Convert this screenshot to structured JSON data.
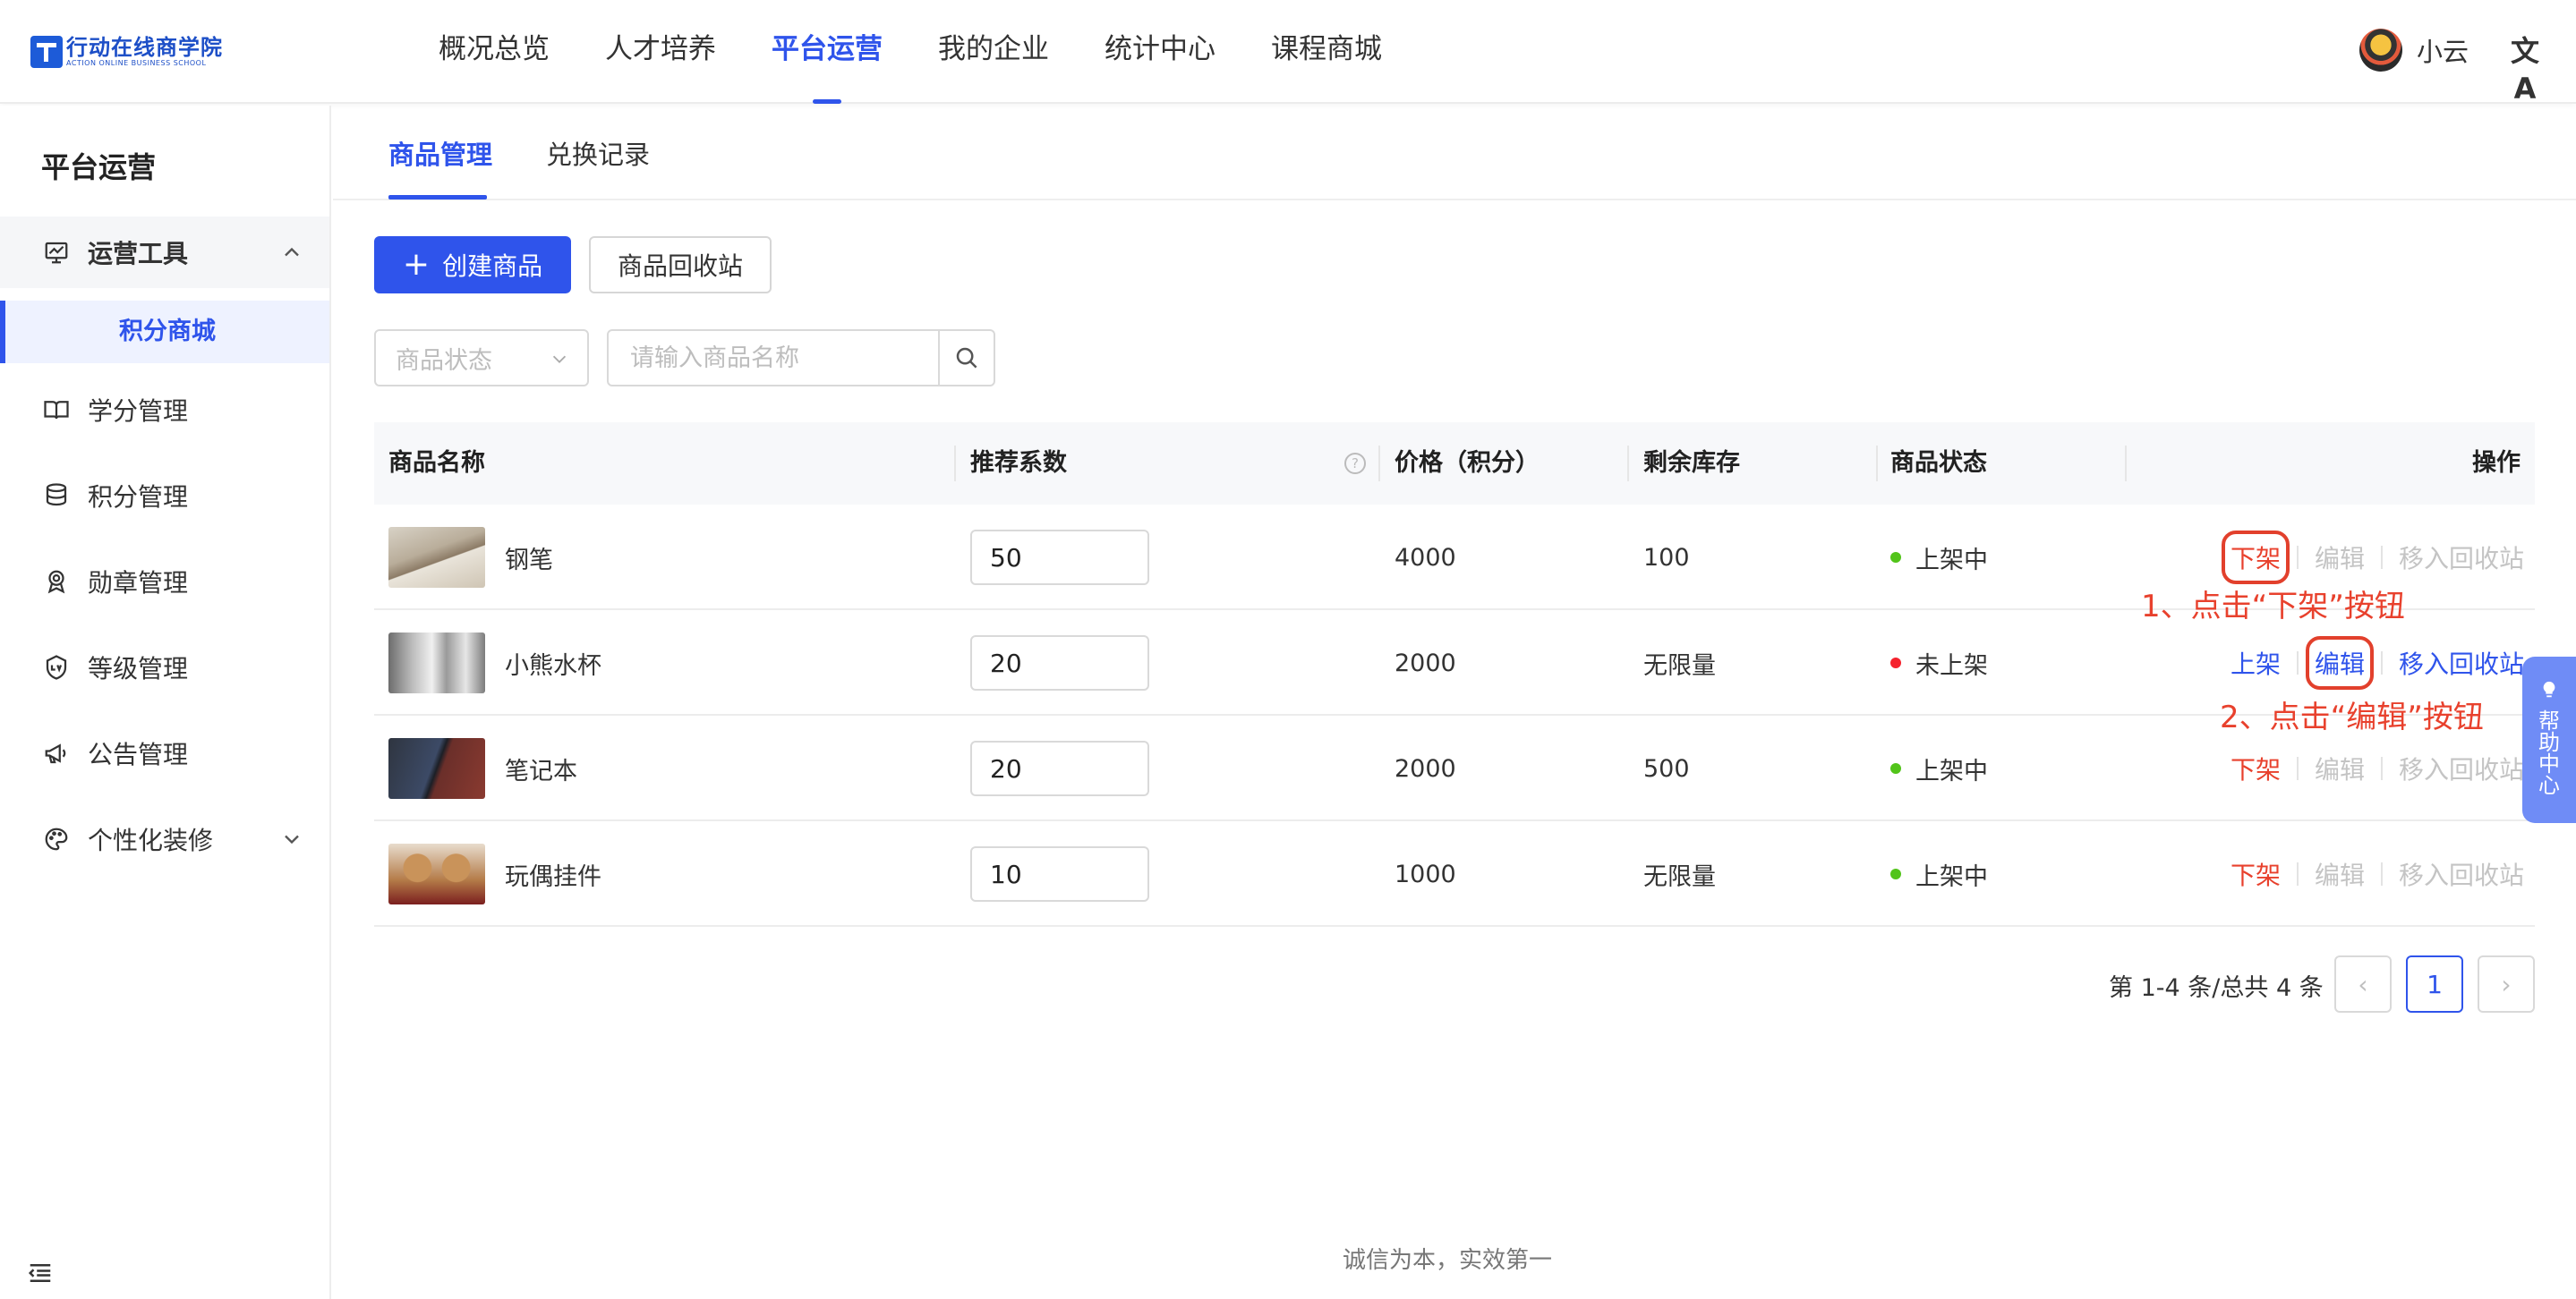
{
  "header": {
    "logo_cn": "行动在线商学院",
    "logo_en": "ACTION ONLINE BUSINESS SCHOOL",
    "nav": [
      {
        "label": "概况总览"
      },
      {
        "label": "人才培养"
      },
      {
        "label": "平台运营"
      },
      {
        "label": "我的企业"
      },
      {
        "label": "统计中心"
      },
      {
        "label": "课程商城"
      }
    ],
    "user_name": "小云",
    "translate_glyph": "文A"
  },
  "sidebar": {
    "title": "平台运营",
    "group": {
      "label": "运营工具",
      "icon": "monitor-chart-icon"
    },
    "sub_item": "积分商城",
    "items": [
      {
        "label": "学分管理",
        "icon": "book-icon"
      },
      {
        "label": "积分管理",
        "icon": "coins-icon"
      },
      {
        "label": "勋章管理",
        "icon": "medal-icon"
      },
      {
        "label": "等级管理",
        "icon": "level-shield-icon"
      },
      {
        "label": "公告管理",
        "icon": "megaphone-icon"
      },
      {
        "label": "个性化装修",
        "icon": "palette-icon"
      }
    ]
  },
  "tabs": [
    {
      "label": "商品管理"
    },
    {
      "label": "兑换记录"
    }
  ],
  "toolbar": {
    "create_label": "创建商品",
    "recycle_label": "商品回收站"
  },
  "filters": {
    "status_placeholder": "商品状态",
    "search_placeholder": "请输入商品名称"
  },
  "table": {
    "columns": {
      "name": "商品名称",
      "weight": "推荐系数",
      "price": "价格（积分）",
      "stock": "剩余库存",
      "status": "商品状态",
      "ops": "操作"
    },
    "rows": [
      {
        "name": "钢笔",
        "weight": "50",
        "price": "4000",
        "stock": "100",
        "status": "上架中",
        "status_color": "#52c41a",
        "a1": "下架",
        "a2": "编辑",
        "a3": "移入回收站"
      },
      {
        "name": "小熊水杯",
        "weight": "20",
        "price": "2000",
        "stock": "无限量",
        "status": "未上架",
        "status_color": "#f5222d",
        "a1": "上架",
        "a2": "编辑",
        "a3": "移入回收站"
      },
      {
        "name": "笔记本",
        "weight": "20",
        "price": "2000",
        "stock": "500",
        "status": "上架中",
        "status_color": "#52c41a",
        "a1": "下架",
        "a2": "编辑",
        "a3": "移入回收站"
      },
      {
        "name": "玩偶挂件",
        "weight": "10",
        "price": "1000",
        "stock": "无限量",
        "status": "上架中",
        "status_color": "#52c41a",
        "a1": "下架",
        "a2": "编辑",
        "a3": "移入回收站"
      }
    ]
  },
  "annotations": {
    "step1": "1、点击“下架”按钮",
    "step2": "2、点击“编辑”按钮"
  },
  "pagination": {
    "summary": "第 1-4 条/总共 4 条",
    "current_page": "1",
    "prev": "‹",
    "next": "›"
  },
  "footer": "诚信为本，实效第一",
  "help_tab": [
    "帮",
    "助",
    "中",
    "心"
  ],
  "colors": {
    "primary": "#2f54eb",
    "danger": "#e8412d",
    "success": "#52c41a"
  }
}
